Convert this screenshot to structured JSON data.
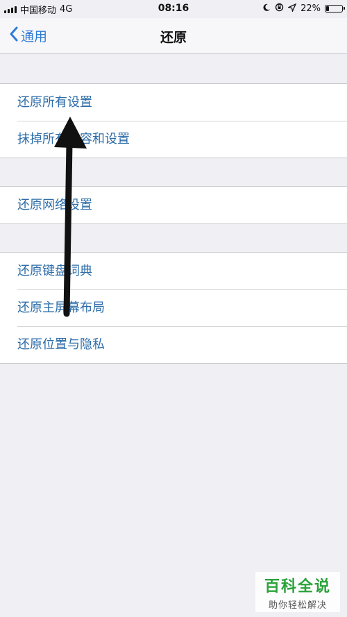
{
  "status_bar": {
    "carrier": "中国移动",
    "network": "4G",
    "time": "08:16",
    "battery_percent": "22%",
    "battery_level": 0.22,
    "icons": [
      "signal-icon",
      "moon-icon",
      "orientation-lock-icon",
      "location-icon",
      "battery-icon"
    ]
  },
  "nav": {
    "back_label": "通用",
    "title": "还原"
  },
  "groups": [
    {
      "items": [
        "还原所有设置",
        "抹掉所有内容和设置"
      ]
    },
    {
      "items": [
        "还原网络设置"
      ]
    },
    {
      "items": [
        "还原键盘词典",
        "还原主屏幕布局",
        "还原位置与隐私"
      ]
    }
  ],
  "watermark": {
    "title": "百科全说",
    "subtitle": "助你轻松解决"
  },
  "colors": {
    "background": "#efeff4",
    "link": "#2c6ca8",
    "accent": "#2f7bd6",
    "watermark_green": "#2aa33a"
  }
}
